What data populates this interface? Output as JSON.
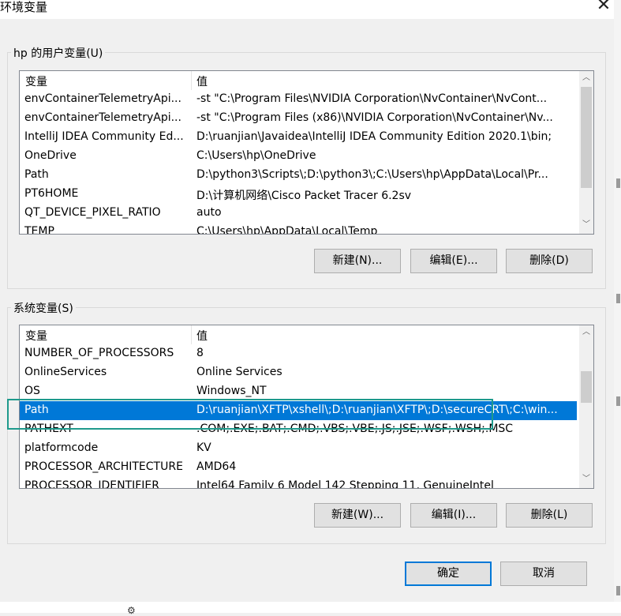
{
  "window": {
    "title": "环境变量",
    "close_glyph": "✕"
  },
  "user_vars": {
    "label": "hp 的用户变量(U)",
    "columns": [
      "变量",
      "值"
    ],
    "rows": [
      {
        "name": "envContainerTelemetryApi...",
        "value": "-st \"C:\\Program Files\\NVIDIA Corporation\\NvContainer\\NvCont..."
      },
      {
        "name": "envContainerTelemetryApi...",
        "value": "-st \"C:\\Program Files (x86)\\NVIDIA Corporation\\NvContainer\\Nv..."
      },
      {
        "name": "IntelliJ IDEA Community Ed...",
        "value": "D:\\ruanjian\\Javaidea\\IntelliJ IDEA Community Edition 2020.1\\bin;"
      },
      {
        "name": "OneDrive",
        "value": "C:\\Users\\hp\\OneDrive"
      },
      {
        "name": "Path",
        "value": "D:\\python3\\Scripts\\;D:\\python3\\;C:\\Users\\hp\\AppData\\Local\\Pr..."
      },
      {
        "name": "PT6HOME",
        "value": "D:\\计算机网络\\Cisco Packet Tracer 6.2sv"
      },
      {
        "name": "QT_DEVICE_PIXEL_RATIO",
        "value": "auto"
      },
      {
        "name": "TEMP",
        "value": "C:\\Users\\hp\\AppData\\Local\\Temp"
      }
    ],
    "buttons": {
      "new": "新建(N)...",
      "edit": "编辑(E)...",
      "delete": "删除(D)"
    }
  },
  "system_vars": {
    "label": "系统变量(S)",
    "columns": [
      "变量",
      "值"
    ],
    "rows": [
      {
        "name": "NUMBER_OF_PROCESSORS",
        "value": "8"
      },
      {
        "name": "OnlineServices",
        "value": "Online Services"
      },
      {
        "name": "OS",
        "value": "Windows_NT"
      },
      {
        "name": "Path",
        "value": "D:\\ruanjian\\XFTP\\xshell\\;D:\\ruanjian\\XFTP\\;D:\\secureCRT\\;C:\\win..."
      },
      {
        "name": "PATHEXT",
        "value": ".COM;.EXE;.BAT;.CMD;.VBS;.VBE;.JS;.JSE;.WSF;.WSH;.MSC"
      },
      {
        "name": "platformcode",
        "value": "KV"
      },
      {
        "name": "PROCESSOR_ARCHITECTURE",
        "value": "AMD64"
      },
      {
        "name": "PROCESSOR_IDENTIFIER",
        "value": "Intel64 Family 6 Model 142 Stepping 11, GenuineIntel"
      }
    ],
    "selected_index": 3,
    "buttons": {
      "new": "新建(W)...",
      "edit": "编辑(I)...",
      "delete": "删除(L)"
    }
  },
  "dialog_buttons": {
    "ok": "确定",
    "cancel": "取消"
  },
  "icons": {
    "scroll_up": "chevron-up-icon",
    "scroll_down": "chevron-down-icon",
    "close": "close-icon"
  }
}
